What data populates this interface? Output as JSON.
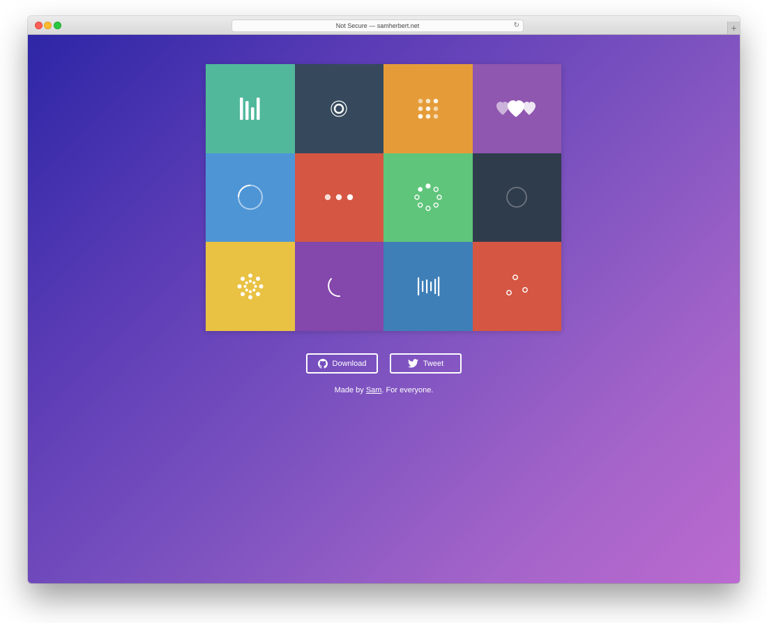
{
  "browser": {
    "address": "Not Secure — samherbert.net",
    "reload_glyph": "↻",
    "new_tab_glyph": "+"
  },
  "tiles": [
    {
      "color": "#52b89c",
      "icon": "bars-loader-icon"
    },
    {
      "color": "#36495c",
      "icon": "concentric-circles-loader-icon"
    },
    {
      "color": "#e59c38",
      "icon": "dot-grid-loader-icon"
    },
    {
      "color": "#8f57b0",
      "icon": "hearts-loader-icon"
    },
    {
      "color": "#4e95d6",
      "icon": "ring-loader-icon"
    },
    {
      "color": "#d55642",
      "icon": "three-dots-loader-icon"
    },
    {
      "color": "#5fc57b",
      "icon": "circle-dots-loader-icon"
    },
    {
      "color": "#2f3c4b",
      "icon": "faint-ring-loader-icon"
    },
    {
      "color": "#e9c244",
      "icon": "dot-burst-loader-icon"
    },
    {
      "color": "#8447ab",
      "icon": "arc-spinner-loader-icon"
    },
    {
      "color": "#3f7fb8",
      "icon": "audio-bars-loader-icon"
    },
    {
      "color": "#d55642",
      "icon": "orbit-dots-loader-icon"
    }
  ],
  "actions": {
    "download_label": "Download",
    "tweet_label": "Tweet"
  },
  "footer": {
    "prefix": "Made by ",
    "link": "Sam",
    "suffix": ". For everyone."
  }
}
